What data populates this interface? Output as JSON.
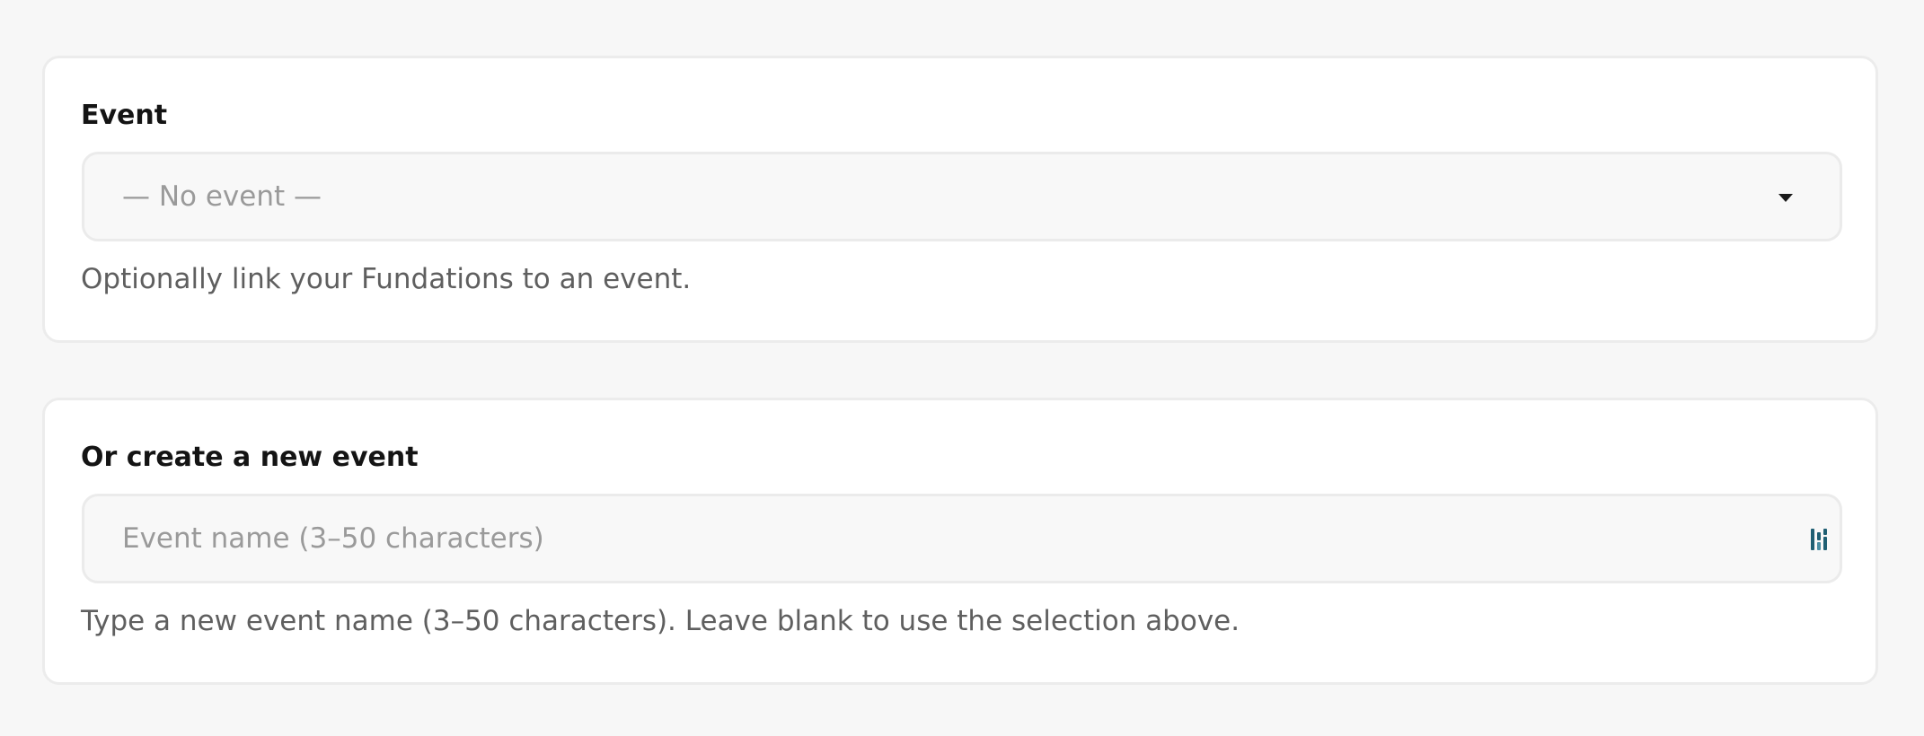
{
  "event_section": {
    "label": "Event",
    "select": {
      "selected_value": "— No event —"
    },
    "help": "Optionally link your Fundations to an event."
  },
  "new_event_section": {
    "label": "Or create a new event",
    "input": {
      "value": "",
      "placeholder": "Event name (3–50 characters)"
    },
    "help": "Type a new event name (3–50 characters). Leave blank to use the selection above."
  },
  "icons": {
    "select_caret": "caret-down-icon",
    "input_extension": "password-manager-icon"
  },
  "colors": {
    "page_background": "#f7f7f7",
    "card_background": "#ffffff",
    "field_background": "#f8f8f8",
    "password_manager_icon": "#1f5f73"
  }
}
